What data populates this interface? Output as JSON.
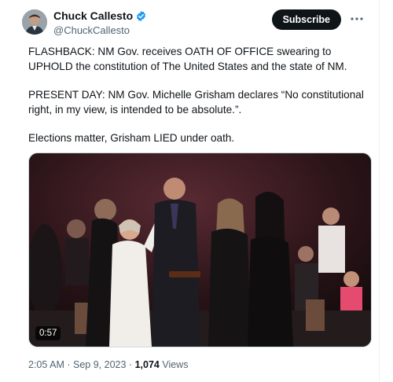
{
  "author": {
    "display_name": "Chuck Callesto",
    "handle": "@ChuckCallesto",
    "verified": true,
    "avatar_icon": "avatar-photo-icon"
  },
  "actions": {
    "subscribe_label": "Subscribe",
    "more_icon": "more-options-icon"
  },
  "tweet": {
    "paragraphs": [
      "FLASHBACK: NM Gov. receives OATH OF OFFICE swearing to UPHOLD the constitution of The United States and the state of NM.",
      "PRESENT DAY: NM Gov. Michelle Grisham declares “No constitutional right, in my view, is intended to be absolute.”.",
      "Elections matter, Grisham LIED under oath."
    ]
  },
  "media": {
    "type": "video",
    "duration": "0:57"
  },
  "meta": {
    "time": "2:05 AM",
    "separator": "·",
    "date": "Sep 9, 2023",
    "views_count": "1,074",
    "views_label": "Views"
  },
  "colors": {
    "text": "#0f1419",
    "secondary": "#536471",
    "verified": "#1d9bf0",
    "button": "#0f1419"
  }
}
